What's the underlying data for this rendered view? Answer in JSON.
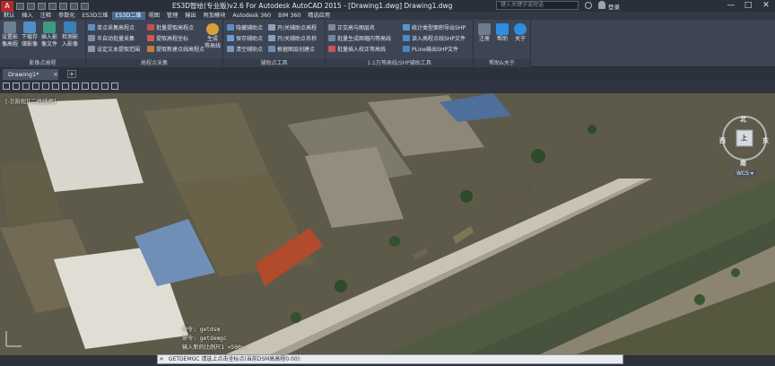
{
  "titlebar": {
    "app_logo_letter": "A",
    "title": "ES3D智绘(专业版)v2.6 For Autodesk AutoCAD 2015 - [Drawing1.dwg]      Drawing1.dwg",
    "search_placeholder": "键入关键字或短语",
    "login_label": "登录",
    "minimize": "—",
    "maximize": "□",
    "close": "✕"
  },
  "menubar": {
    "items": [
      "默认",
      "插入",
      "注释",
      "参数化",
      "ES3D三维",
      "ES3D二维",
      "视图",
      "管理",
      "输出",
      "附加模块",
      "Autodesk 360",
      "BIM 360",
      "精选应用"
    ],
    "active_index": 5
  },
  "ribbon": {
    "panel1": {
      "title": "影像点高程",
      "big_buttons": [
        "设置影像高程",
        "下载影像",
        "插入影像",
        "检测影像",
        "加入影像"
      ],
      "labels_row1": [
        "设置影",
        "下载存",
        "插入影",
        "检测影"
      ],
      "labels_row2": [
        "像高程",
        "储影像",
        "像文件",
        "入影像"
      ]
    },
    "panel2": {
      "title": "高程点采集",
      "buttons": [
        "单点采集高程点",
        "半自动批量采集",
        "设定文本提取范围",
        "批量提取高程点",
        "提取高程坐标",
        "提取新建点线高程点"
      ],
      "big_button": "生成等高线",
      "big_button_row1": "生成",
      "big_button_row2": "等高线"
    },
    "panel3": {
      "title": "辅助点工具",
      "buttons": [
        "隐藏辅助点",
        "保存辅助点",
        "清空辅助点",
        "开/关辅助点高程",
        "开/关辅助点名称",
        "根据图层创建点"
      ]
    },
    "panel4": {
      "title": "1:1万等高线/SHP辅助工具",
      "buttons": [
        "正交高与图层名",
        "批量生成图幅内等高线",
        "批量插入校正等高线",
        "统计类型面积导出SHP",
        "读入高程点线SHP文件",
        "PLine输出SHP文件"
      ]
    },
    "panel5": {
      "title": "帮助&关于",
      "buttons": [
        "注册",
        "帮助",
        "关于"
      ]
    }
  },
  "doc_tabs": {
    "tabs": [
      "Drawing1*"
    ],
    "close_glyph": "×",
    "add_glyph": "+"
  },
  "viewport": {
    "hud_label": "[-][俯视][二维线框]",
    "compass": {
      "north": "北",
      "south": "南",
      "west": "西",
      "east": "东",
      "center": "上",
      "wcs": "WCS ▾"
    }
  },
  "command": {
    "history": [
      "命令:  getdsm",
      "命令:  getdemgc",
      "输入新的比例尺1 <500>:"
    ],
    "close_glyph": "✕",
    "current": "GETDEMGC 请选上点击坐标点(当前DSM高高程0.00):"
  },
  "colors": {
    "accent": "#4a6b92",
    "ribbon_bg": "#3d4554",
    "water": "#4d5a40",
    "road": "#c8c2b3"
  }
}
